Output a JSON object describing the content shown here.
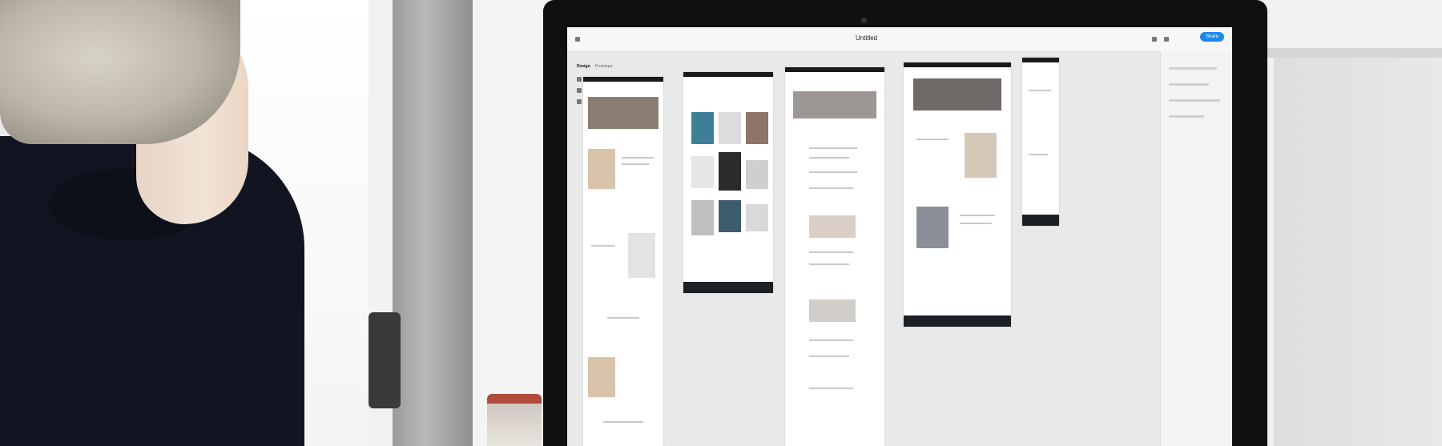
{
  "screen": {
    "doc_title": "Untitled",
    "share_label": "Share",
    "tabs": [
      "Design",
      "Prototype"
    ],
    "artboards": [
      {
        "label": ""
      },
      {
        "label": ""
      },
      {
        "label": ""
      },
      {
        "label": ""
      },
      {
        "label": ""
      }
    ]
  },
  "colors": {
    "accent": "#1e88e5",
    "bezel": "#101010",
    "footer": "#1d2125",
    "sweater": "#121521"
  }
}
